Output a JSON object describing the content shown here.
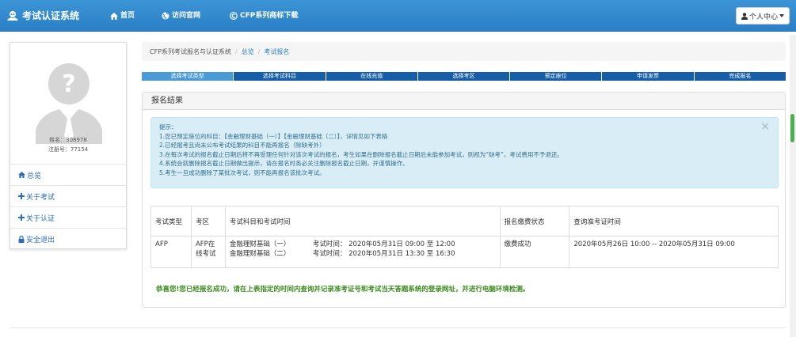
{
  "navbar": {
    "brand": "考试认证系统",
    "items": [
      {
        "label": "首页",
        "icon": "home-icon"
      },
      {
        "label": "访问官网",
        "icon": "globe-icon"
      },
      {
        "label": "CFP系列商标下载",
        "icon": "copyright-icon"
      }
    ],
    "user_menu": "个人中心"
  },
  "sidebar": {
    "name_label": "姓名：308978",
    "reg_label": "注册号：77154",
    "menu": [
      {
        "label": "总览",
        "icon": "home-icon"
      },
      {
        "label": "关于考试",
        "icon": "plus-icon"
      },
      {
        "label": "关于认证",
        "icon": "plus-icon"
      },
      {
        "label": "安全退出",
        "icon": "lock-icon"
      }
    ]
  },
  "breadcrumb": {
    "root": "CFP系列考试报名与认证系统",
    "overview": "总览",
    "current": "考试报名"
  },
  "steps": [
    "选择考试类型",
    "选择考试科目",
    "在线充值",
    "选择考区",
    "预定座位",
    "申请发票",
    "完成报名"
  ],
  "panel": {
    "title": "报名结果",
    "alert": {
      "lines": [
        "提示：",
        "1.您已预定座位的科目：【金融理财基础（一）】【金融理财基础（二）】，详情见如下表格",
        "2.已经报考且尚未公布考试结果的科目不能再报名（除缺考外）",
        "3.在每次考试的报名截止日期后将不再受理任何针对该次考试的报名，考生如果在删除报名截止日期后未能参加考试，则视为“缺考”，考试费用不予退还。",
        "4.系统会就删除报名截止日期做出提示，请在报名时务必关注删除报名截止日期，并谨慎操作。",
        "5.考生一旦成功删除了某批次考试，则不能再报名该批次考试。"
      ]
    },
    "table": {
      "headers": [
        "考试类型",
        "考区",
        "考试科目和考试时间",
        "报名缴费状态",
        "查询准考证时间"
      ],
      "row": {
        "type": "AFP",
        "area": "AFP在线考试",
        "subjects": [
          {
            "name": "金融理财基础（一）",
            "time": "考试时间：  2020年05月31日 09:00 至 12:00"
          },
          {
            "name": "金融理财基础（二）",
            "time": "考试时间：  2020年05月31日 13:30 至 16:30"
          }
        ],
        "status": "缴费成功",
        "query_time": "2020年05月26日 10:00 -- 2020年05月31日 09:00"
      }
    },
    "success": "恭喜您!您已经报名成功，请在上表指定的时间内查询并记录准考证号和考试当天答题系统的登录网址，并进行电脑环境检测。"
  }
}
